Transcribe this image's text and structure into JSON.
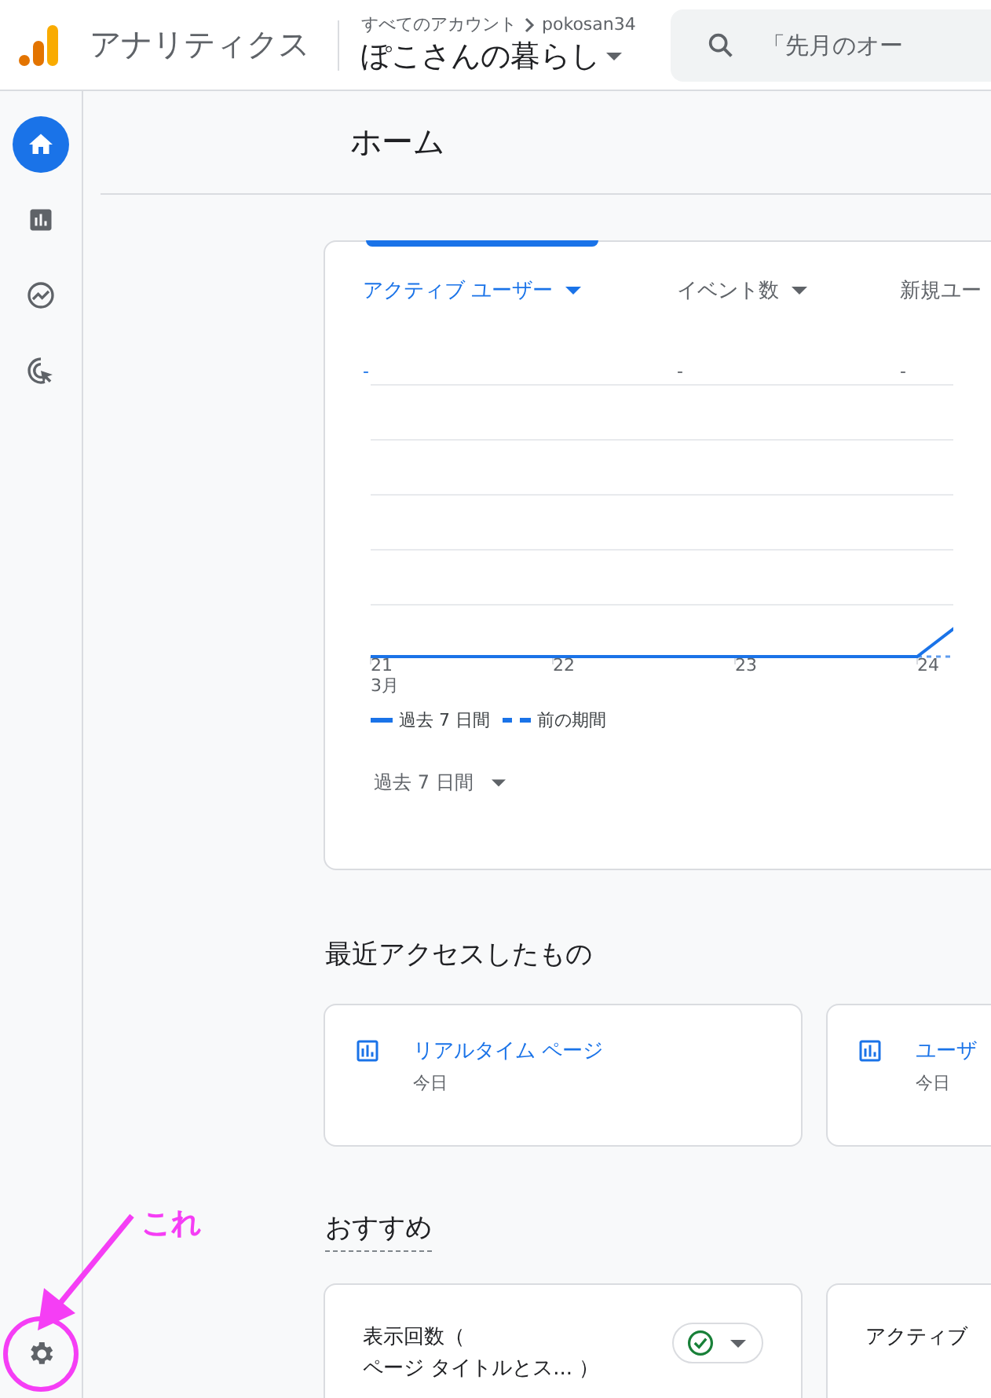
{
  "header": {
    "product": "アナリティクス",
    "breadcrumb": "すべてのアカウント",
    "account": "pokosan34",
    "property": "ぽこさんの暮らし",
    "search_placeholder": "「先月のオー"
  },
  "sidebar": {
    "items": [
      {
        "kind": "home",
        "selected": true
      },
      {
        "kind": "reports",
        "selected": false
      },
      {
        "kind": "explore",
        "selected": false
      },
      {
        "kind": "advertising",
        "selected": false
      }
    ],
    "settings": {
      "kind": "settings",
      "selected": false
    }
  },
  "page_title": "ホーム",
  "overview": {
    "metrics": [
      {
        "label": "アクティブ ユーザー",
        "value": "-",
        "selected": true
      },
      {
        "label": "イベント数",
        "value": "-",
        "selected": false
      },
      {
        "label": "新規ユー",
        "value": "-",
        "selected": false
      }
    ],
    "x_labels": [
      "21",
      "22",
      "23",
      "24"
    ],
    "month_label": "3月",
    "legend": [
      {
        "label": "過去 7 日間",
        "kind": "solid"
      },
      {
        "label": "前の期間",
        "kind": "dashed"
      }
    ],
    "range": "過去 7 日間"
  },
  "recent": {
    "title": "最近アクセスしたもの",
    "items": [
      {
        "title": "リアルタイム ページ",
        "subtitle": "今日"
      },
      {
        "title": "ユーザ",
        "subtitle": "今日"
      }
    ]
  },
  "recommended": {
    "title": "おすすめ",
    "cards": [
      {
        "lines": [
          "表示回数（",
          "ページ タイトルとス... ）"
        ],
        "checked": true
      },
      {
        "lines": [
          "アクティブ"
        ]
      }
    ]
  },
  "annotation": {
    "label": "これ"
  }
}
